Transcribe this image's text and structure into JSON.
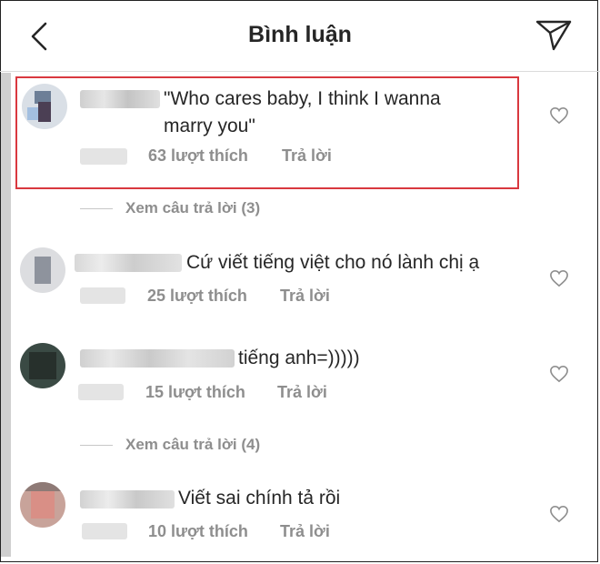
{
  "header": {
    "title": "Bình luận",
    "back_icon": "chevron-left-icon",
    "send_icon": "paper-plane-icon"
  },
  "comments": [
    {
      "text": "\"Who cares baby, I think I wanna\nmarry you\"",
      "likes": "63 lượt thích",
      "reply": "Trả lời",
      "highlighted": true
    },
    {
      "text": "Cứ viết tiếng việt cho nó lành chị ạ",
      "likes": "25 lượt thích",
      "reply": "Trả lời"
    },
    {
      "text": "tiếng anh=)))))",
      "likes": "15 lượt thích",
      "reply": "Trả lời"
    },
    {
      "text": "Viết sai chính tả rồi",
      "likes": "10 lượt thích",
      "reply": "Trả lời"
    }
  ],
  "view_replies": [
    {
      "label": "Xem câu trả lời (3)"
    },
    {
      "label": "Xem câu trả lời (4)"
    }
  ],
  "colors": {
    "highlight_border": "#d9383f",
    "meta": "#8e8e8e",
    "text": "#262626"
  }
}
